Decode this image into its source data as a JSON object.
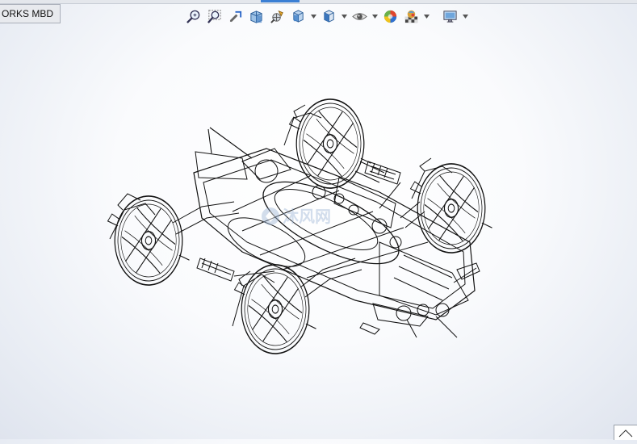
{
  "tabs": {
    "active_label": "ORKS MBD"
  },
  "heads_up_toolbar": {
    "buttons": [
      "zoom-to-fit-icon",
      "zoom-to-area-icon",
      "previous-view-icon",
      "section-view-icon",
      "dynamic-annotation-views-icon",
      "view-orientation-icon",
      "display-style-icon",
      "hide-show-items-icon",
      "edit-appearance-icon",
      "apply-scene-icon",
      "view-settings-icon"
    ]
  },
  "viewport": {
    "model": "drone-car-assembly-wireframe",
    "watermark": "沐风网"
  },
  "colors": {
    "line": "#111111",
    "background": "#f7f8fb",
    "accent": "#3b7fd4"
  }
}
